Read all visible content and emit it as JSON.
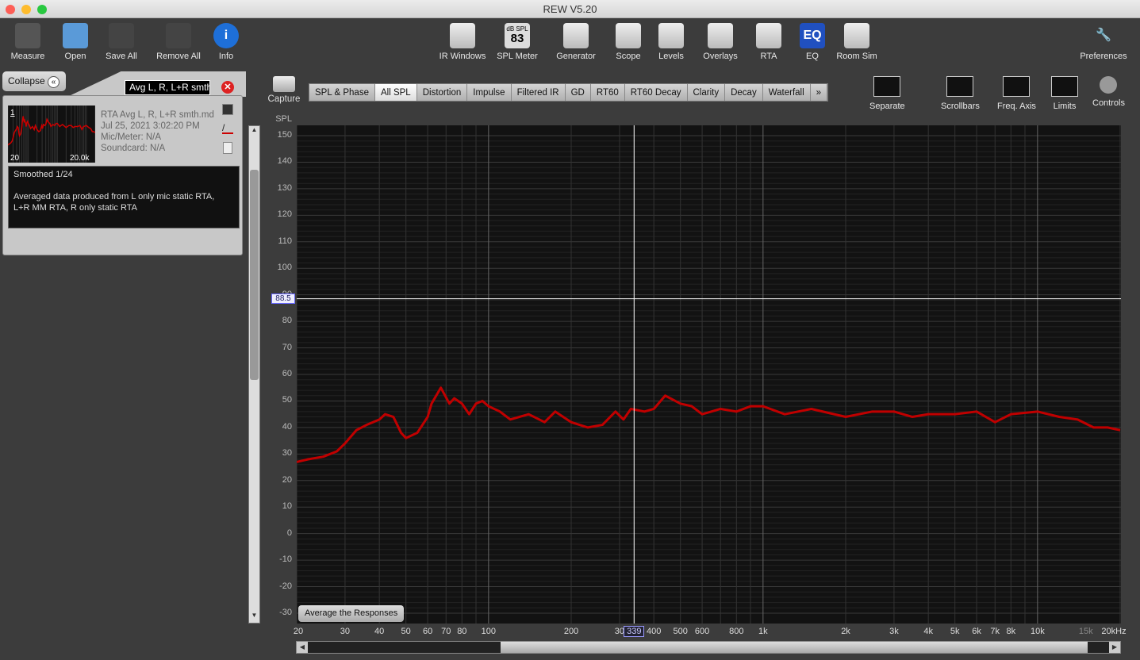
{
  "window": {
    "title": "REW V5.20"
  },
  "toolbar_left": [
    {
      "label": "Measure",
      "icon": "measure-icon"
    },
    {
      "label": "Open",
      "icon": "folder-icon"
    },
    {
      "label": "Save All",
      "icon": "save-all-icon"
    },
    {
      "label": "Remove All",
      "icon": "remove-all-icon"
    },
    {
      "label": "Info",
      "icon": "info-icon"
    }
  ],
  "toolbar_center": [
    {
      "label": "IR Windows",
      "icon": "ir-windows-icon"
    },
    {
      "label": "SPL Meter",
      "icon": "spl-meter-icon",
      "badge": "83",
      "badge_top": "dB SPL"
    },
    {
      "label": "Generator",
      "icon": "generator-icon"
    },
    {
      "label": "Scope",
      "icon": "scope-icon"
    },
    {
      "label": "Levels",
      "icon": "levels-icon"
    },
    {
      "label": "Overlays",
      "icon": "overlays-icon"
    },
    {
      "label": "RTA",
      "icon": "rta-icon"
    },
    {
      "label": "EQ",
      "icon": "eq-icon"
    },
    {
      "label": "Room Sim",
      "icon": "room-sim-icon"
    }
  ],
  "toolbar_right": {
    "label": "Preferences",
    "icon": "wrench-icon"
  },
  "panel": {
    "collapse_label": "Collapse",
    "name_value": "Avg L, R, L+R smth",
    "index": "1",
    "thumb_xmin": "20",
    "thumb_xmax": "20.0k",
    "title": "RTA Avg L, R, L+R smth.mdat",
    "date": "Jul 25, 2021 3:02:20 PM",
    "mic": "Mic/Meter: N/A",
    "soundcard": "Soundcard: N/A",
    "notes_line1": "Smoothed 1/24",
    "notes_line2": "Averaged data produced from L only mic static RTA,",
    "notes_line3": "L+R MM RTA, R only static RTA"
  },
  "graph_toolbar": {
    "capture": "Capture",
    "tabs": [
      "SPL & Phase",
      "All SPL",
      "Distortion",
      "Impulse",
      "Filtered IR",
      "GD",
      "RT60",
      "RT60 Decay",
      "Clarity",
      "Decay",
      "Waterfall",
      "»"
    ],
    "active_tab": "All SPL",
    "right_buttons": [
      "Separate",
      "Scrollbars",
      "Freq. Axis",
      "Limits",
      "Controls"
    ]
  },
  "average_button": "Average the Responses",
  "chart_data": {
    "type": "line",
    "ylabel": "SPL",
    "xlabel": "",
    "xunit": "Hz",
    "xscale": "log",
    "xlim": [
      20,
      20000
    ],
    "ylim": [
      -30,
      150
    ],
    "yticks": [
      150,
      140,
      130,
      120,
      110,
      100,
      90,
      80,
      70,
      60,
      50,
      40,
      30,
      20,
      10,
      0,
      -10,
      -20,
      -30
    ],
    "xticks": [
      {
        "v": 20,
        "l": "20"
      },
      {
        "v": 30,
        "l": "30"
      },
      {
        "v": 40,
        "l": "40"
      },
      {
        "v": 50,
        "l": "50"
      },
      {
        "v": 60,
        "l": "60"
      },
      {
        "v": 70,
        "l": "70"
      },
      {
        "v": 80,
        "l": "80"
      },
      {
        "v": 100,
        "l": "100"
      },
      {
        "v": 200,
        "l": "200"
      },
      {
        "v": 300,
        "l": "30"
      },
      {
        "v": 400,
        "l": "400"
      },
      {
        "v": 500,
        "l": "500"
      },
      {
        "v": 600,
        "l": "600"
      },
      {
        "v": 800,
        "l": "800"
      },
      {
        "v": 1000,
        "l": "1k"
      },
      {
        "v": 2000,
        "l": "2k"
      },
      {
        "v": 3000,
        "l": "3k"
      },
      {
        "v": 4000,
        "l": "4k"
      },
      {
        "v": 5000,
        "l": "5k"
      },
      {
        "v": 6000,
        "l": "6k"
      },
      {
        "v": 7000,
        "l": "7k"
      },
      {
        "v": 8000,
        "l": "8k"
      },
      {
        "v": 10000,
        "l": "10k"
      },
      {
        "v": 15000,
        "l": "15k"
      },
      {
        "v": 20000,
        "l": "20kHz"
      }
    ],
    "cursor": {
      "x": 339,
      "x_label": "339",
      "y": 88.5,
      "y_label": "88.5"
    },
    "grid": true,
    "line_color": "#c00000",
    "series": [
      {
        "x": [
          20,
          22,
          25,
          28,
          30,
          33,
          36,
          40,
          42,
          45,
          48,
          50,
          55,
          60,
          62,
          67,
          72,
          75,
          80,
          85,
          90,
          95,
          100,
          110,
          120,
          140,
          160,
          175,
          200,
          230,
          260,
          290,
          310,
          330,
          370,
          400,
          440,
          500,
          550,
          600,
          700,
          800,
          900,
          1000,
          1200,
          1500,
          2000,
          2500,
          3000,
          3500,
          4000,
          5000,
          6000,
          7000,
          8000,
          10000,
          12000,
          14000,
          16000,
          18000,
          20000
        ],
        "y": [
          27,
          28,
          29,
          31,
          34,
          39,
          41,
          43,
          45,
          44,
          38,
          36,
          38,
          44,
          49,
          55,
          49,
          51,
          49,
          45,
          49,
          50,
          48,
          46,
          43,
          45,
          42,
          46,
          42,
          40,
          41,
          46,
          43,
          47,
          46,
          47,
          52,
          49,
          48,
          45,
          47,
          46,
          48,
          48,
          45,
          47,
          44,
          46,
          46,
          44,
          45,
          45,
          46,
          42,
          45,
          46,
          44,
          43,
          40,
          40,
          39
        ]
      }
    ]
  }
}
